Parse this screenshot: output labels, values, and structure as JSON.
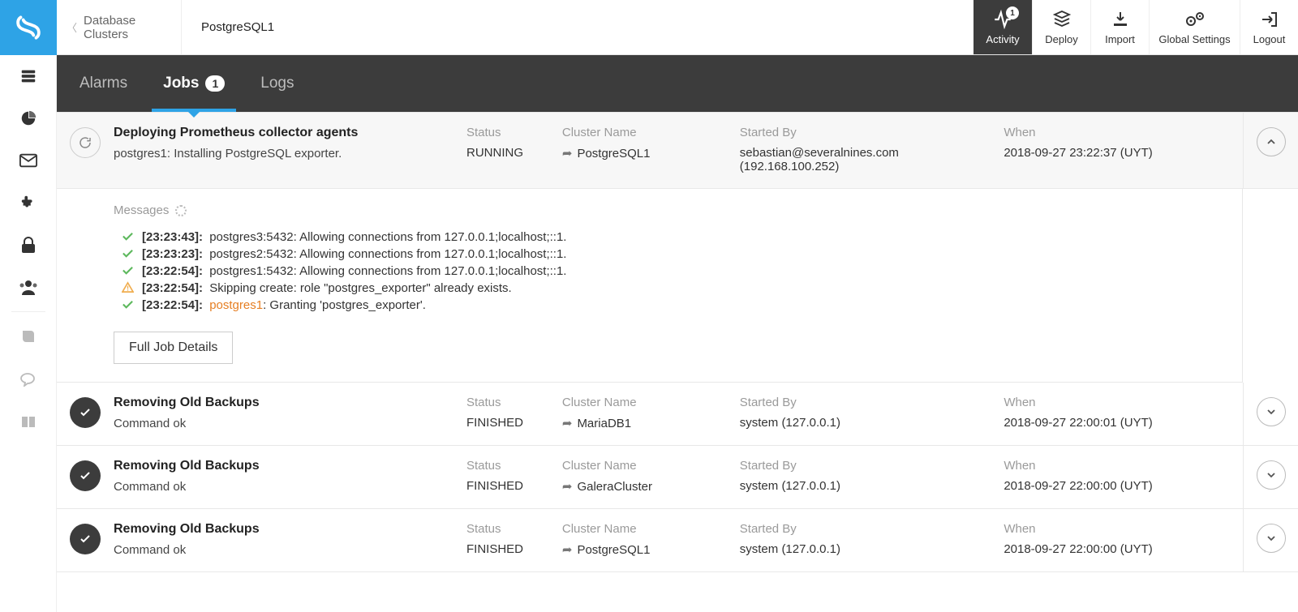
{
  "breadcrumb": {
    "back": "Database Clusters",
    "current": "PostgreSQL1"
  },
  "top_actions": {
    "activity": {
      "label": "Activity",
      "badge": "1"
    },
    "deploy": {
      "label": "Deploy"
    },
    "import": {
      "label": "Import"
    },
    "settings": {
      "label": "Global Settings"
    },
    "logout": {
      "label": "Logout"
    }
  },
  "tabs": {
    "alarms": "Alarms",
    "jobs": "Jobs",
    "jobs_count": "1",
    "logs": "Logs"
  },
  "labels": {
    "status": "Status",
    "cluster": "Cluster Name",
    "by": "Started By",
    "when": "When",
    "messages": "Messages",
    "full": "Full Job Details"
  },
  "jobs": [
    {
      "title": "Deploying Prometheus collector agents",
      "sub": "postgres1: Installing PostgreSQL exporter.",
      "status": "RUNNING",
      "cluster": "PostgreSQL1",
      "by_line1": "sebastian@severalnines.com",
      "by_line2": "(192.168.100.252)",
      "when": "2018-09-27 23:22:37 (UYT)"
    },
    {
      "title": "Removing Old Backups",
      "sub": "Command ok",
      "status": "FINISHED",
      "cluster": "MariaDB1",
      "by_line1": "system (127.0.0.1)",
      "by_line2": "",
      "when": "2018-09-27 22:00:01 (UYT)"
    },
    {
      "title": "Removing Old Backups",
      "sub": "Command ok",
      "status": "FINISHED",
      "cluster": "GaleraCluster",
      "by_line1": "system (127.0.0.1)",
      "by_line2": "",
      "when": "2018-09-27 22:00:00 (UYT)"
    },
    {
      "title": "Removing Old Backups",
      "sub": "Command ok",
      "status": "FINISHED",
      "cluster": "PostgreSQL1",
      "by_line1": "system (127.0.0.1)",
      "by_line2": "",
      "when": "2018-09-27 22:00:00 (UYT)"
    }
  ],
  "messages": [
    {
      "kind": "ok",
      "ts": "[23:23:43]:",
      "text": "postgres3:5432: Allowing connections from 127.0.0.1;localhost;::1."
    },
    {
      "kind": "ok",
      "ts": "[23:23:23]:",
      "text": "postgres2:5432: Allowing connections from 127.0.0.1;localhost;::1."
    },
    {
      "kind": "ok",
      "ts": "[23:22:54]:",
      "text": "postgres1:5432: Allowing connections from 127.0.0.1;localhost;::1."
    },
    {
      "kind": "warn",
      "ts": "[23:22:54]:",
      "text": "Skipping create: role \"postgres_exporter\" already exists."
    },
    {
      "kind": "ok",
      "ts": "[23:22:54]:",
      "host": "postgres1",
      "text": ": Granting 'postgres_exporter'."
    }
  ]
}
